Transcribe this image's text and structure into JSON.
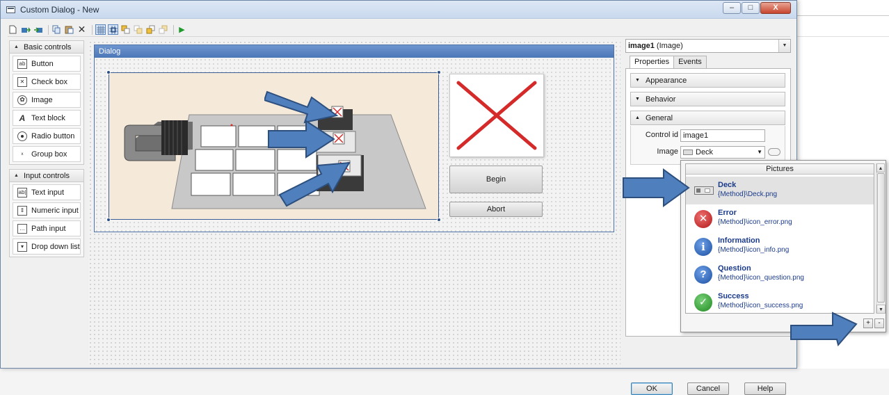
{
  "window": {
    "title": "Custom Dialog - New",
    "min_glyph": "–",
    "max_glyph": "□",
    "close_glyph": "X"
  },
  "palette": {
    "basic_header": "Basic controls",
    "basic_items": [
      {
        "label": "Button",
        "icon": "button-icon"
      },
      {
        "label": "Check box",
        "icon": "checkbox-icon"
      },
      {
        "label": "Image",
        "icon": "image-icon"
      },
      {
        "label": "Text block",
        "icon": "text-block-icon"
      },
      {
        "label": "Radio button",
        "icon": "radio-icon"
      },
      {
        "label": "Group box",
        "icon": "group-box-icon"
      }
    ],
    "input_header": "Input controls",
    "input_items": [
      {
        "label": "Text input",
        "icon": "text-input-icon"
      },
      {
        "label": "Numeric input",
        "icon": "numeric-input-icon"
      },
      {
        "label": "Path input",
        "icon": "path-input-icon"
      },
      {
        "label": "Drop down list",
        "icon": "dropdown-icon"
      }
    ]
  },
  "designer": {
    "dialog_title": "Dialog",
    "begin_label": "Begin",
    "abort_label": "Abort"
  },
  "properties": {
    "object_name": "image1",
    "object_type": "(Image)",
    "tab_properties": "Properties",
    "tab_events": "Events",
    "section_appearance": "Appearance",
    "section_behavior": "Behavior",
    "section_general": "General",
    "control_id_label": "Control id",
    "control_id_value": "image1",
    "image_label": "Image",
    "image_value": "Deck",
    "ok_label": "OK",
    "cancel_label": "Cancel",
    "help_label": "Help"
  },
  "pictures": {
    "header": "Pictures",
    "items": [
      {
        "name": "Deck",
        "path": "{Method}\\Deck.png",
        "icon": "deck-icon",
        "selected": true
      },
      {
        "name": "Error",
        "path": "{Method}\\icon_error.png",
        "icon": "error-icon"
      },
      {
        "name": "Information",
        "path": "{Method}\\icon_info.png",
        "icon": "info-icon"
      },
      {
        "name": "Question",
        "path": "{Method}\\icon_question.png",
        "icon": "question-icon"
      },
      {
        "name": "Success",
        "path": "{Method}\\icon_success.png",
        "icon": "success-icon"
      }
    ],
    "add_label": "+",
    "remove_label": "-"
  },
  "colors": {
    "arrow_fill": "#4f7fbd",
    "arrow_stroke": "#2c4f7e",
    "error_red": "#d42a2a",
    "info_blue": "#1f5fb5",
    "success_green": "#2f9a2f"
  }
}
